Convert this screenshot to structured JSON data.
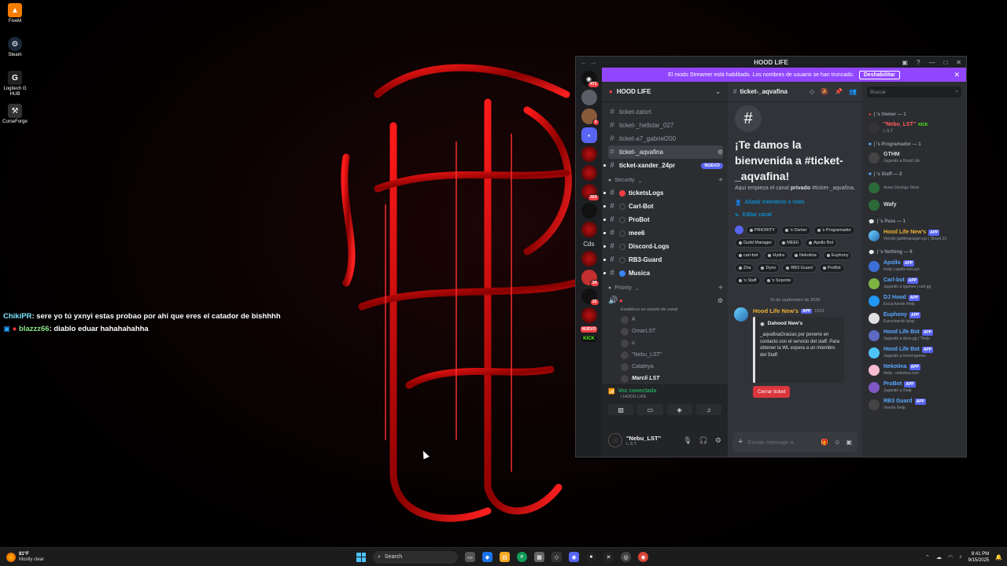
{
  "desktop": {
    "icons": [
      {
        "label": "FiveM",
        "icon": "fivem-icon",
        "color": "#f57c00"
      },
      {
        "label": "Steam",
        "icon": "steam-icon",
        "color": "#1b2838"
      },
      {
        "label": "Logitech G HUB",
        "icon": "logitech-icon",
        "color": "#222"
      },
      {
        "label": "CurseForge",
        "icon": "curseforge-icon",
        "color": "#333"
      }
    ],
    "chat_overlay": [
      {
        "name": "ChikiPR",
        "text": ": sere yo tú yxnyi estas probao por ahi que eres el catador de bishhhh"
      },
      {
        "name": "blazzz66",
        "text": ": diablo eduar hahahahahha"
      }
    ]
  },
  "discord": {
    "window_title": "HOOD LIFE",
    "streamer_banner": {
      "text": "El modo Streamer está habilitado. Los nombres de usuario se han truncado.",
      "button": "Deshabilitar"
    },
    "server_rail": {
      "badges": [
        "471",
        "1",
        "324",
        "22",
        "24",
        "2"
      ],
      "text_items": [
        "Cds",
        "NUEVO",
        "KICK"
      ]
    },
    "guild": {
      "name": "HOOD LIFE",
      "channels": [
        {
          "name": "ticket-zatxrt",
          "state": "normal"
        },
        {
          "name": "ticket-_hellstar_027",
          "state": "normal"
        },
        {
          "name": "ticket-a7_gabriel200",
          "state": "normal"
        },
        {
          "name": "ticket-_aqvafina",
          "state": "selected"
        },
        {
          "name": "ticket-xander_24pr",
          "state": "unread",
          "tag": "NUEVO"
        }
      ],
      "security_category": "Security",
      "security_channels": [
        {
          "name": "ticketsLogs",
          "dot": "red"
        },
        {
          "name": "Carl-Bot",
          "dot": "none"
        },
        {
          "name": "ProBot",
          "dot": "none"
        },
        {
          "name": "mee6",
          "dot": "none"
        },
        {
          "name": "Discord-Logs",
          "dot": "none"
        },
        {
          "name": "RB3-Guard",
          "dot": "none"
        },
        {
          "name": "Musica",
          "dot": "blue"
        }
      ],
      "priority_category": "Priority",
      "voice_status": "Establece un estado de canal",
      "voice_users": [
        {
          "name": "A",
          "bright": false
        },
        {
          "name": "OmarLST",
          "bright": false
        },
        {
          "name": "u",
          "bright": false
        },
        {
          "name": "\"Nebu_LST\"",
          "bright": false
        },
        {
          "name": "Cataleya",
          "bright": false
        },
        {
          "name": "Marcli LST",
          "bright": true
        }
      ]
    },
    "voice_panel": {
      "status": "Voz conectada",
      "server": "/ HOOD LIFE"
    },
    "user_panel": {
      "name": "\"Nebu_LST\"",
      "status": "L.S.T"
    },
    "channel": {
      "name": "ticket-_aqvafina",
      "welcome_title": "¡Te damos la bienvenida a #ticket-_aqvafina!",
      "welcome_desc_pre": "Aquí empieza el canal ",
      "welcome_desc_bold": "privado",
      "welcome_desc_post": " #ticket-_aqvafina.",
      "link_add": "Añadir miembros o roles",
      "link_edit": "Editar canal",
      "roles": [
        "PRIORITY",
        "'s Owner",
        "'s Programador",
        "Guild Manager",
        "MEE6",
        "Apollo Bot",
        "carl-bot",
        "Hydra",
        "Nekotina",
        "Euphony",
        "Zira",
        "Dyno",
        "RB3 Guard",
        "ProBot",
        "'s Staff",
        "'s Soporte"
      ],
      "date_separator": "15 de septiembre de 2025",
      "message": {
        "author": "Hood Life New's",
        "tag": "APP",
        "time": "19:51",
        "embed_title": "Dahood New's",
        "embed_body": "_aqvafinaGracias por ponerte en contacto con el servicio del staff. Para obtener la WL espera a un miembro del Staff.",
        "button": "Cerrar ticket"
      },
      "composer_placeholder": "Enviar mensaje a…"
    },
    "members": {
      "search_placeholder": "Buscar",
      "groups": [
        {
          "title": "| 's Owner — 1",
          "items": [
            {
              "name": "\"Nebu_LST\"",
              "sub": "L.S.T",
              "color": "red",
              "tag": "KICK"
            }
          ]
        },
        {
          "title": "| 's Programador — 1",
          "items": [
            {
              "name": "GTHM",
              "sub": "Jugando a Hood Life",
              "color": "plain"
            }
          ]
        },
        {
          "title": "| 's Staff — 2",
          "items": [
            {
              "name": "",
              "sub": "Asian Desings Store",
              "color": "plain"
            },
            {
              "name": "Wafy",
              "sub": "",
              "color": "plain"
            }
          ]
        },
        {
          "title": "| 's Pass — 1",
          "items": [
            {
              "name": "Hood Life New's",
              "sub": "Viendo guildmanager.xyz | Shard 23",
              "color": "yellow",
              "tag": "APP"
            }
          ]
        },
        {
          "title": "| 's Nothing — 9",
          "items": [
            {
              "name": "Apollo",
              "sub": "/help | apollo-bot.xyz",
              "color": "blue",
              "tag": "APP"
            },
            {
              "name": "Carl-bot",
              "sub": "Jugando a /games | carl.gg",
              "color": "blue",
              "tag": "APP"
            },
            {
              "name": "DJ Hood",
              "sub": "Escuchando /help",
              "color": "blue",
              "tag": "APP"
            },
            {
              "name": "Euphony",
              "sub": "Escuchando /play",
              "color": "blue",
              "tag": "APP"
            },
            {
              "name": "Hood Life Bot",
              "sub": "Jugando a dyno.gg | ?help",
              "color": "blue",
              "tag": "APP"
            },
            {
              "name": "Hood Life Bot",
              "sub": "Jugando a /meet-games",
              "color": "blue",
              "tag": "APP"
            },
            {
              "name": "Nekotina",
              "sub": "/help - nekotina.com",
              "color": "blue",
              "tag": "APP"
            },
            {
              "name": "ProBot",
              "sub": "Jugando a /help",
              "color": "blue",
              "tag": "APP"
            },
            {
              "name": "RB3 Guard",
              "sub": "Viendo /help",
              "color": "blue",
              "tag": "APP"
            }
          ]
        }
      ]
    }
  },
  "taskbar": {
    "weather_temp": "81°F",
    "weather_desc": "Mostly clear",
    "search": "Search",
    "time": "8:41 PM",
    "date": "9/15/2025"
  }
}
